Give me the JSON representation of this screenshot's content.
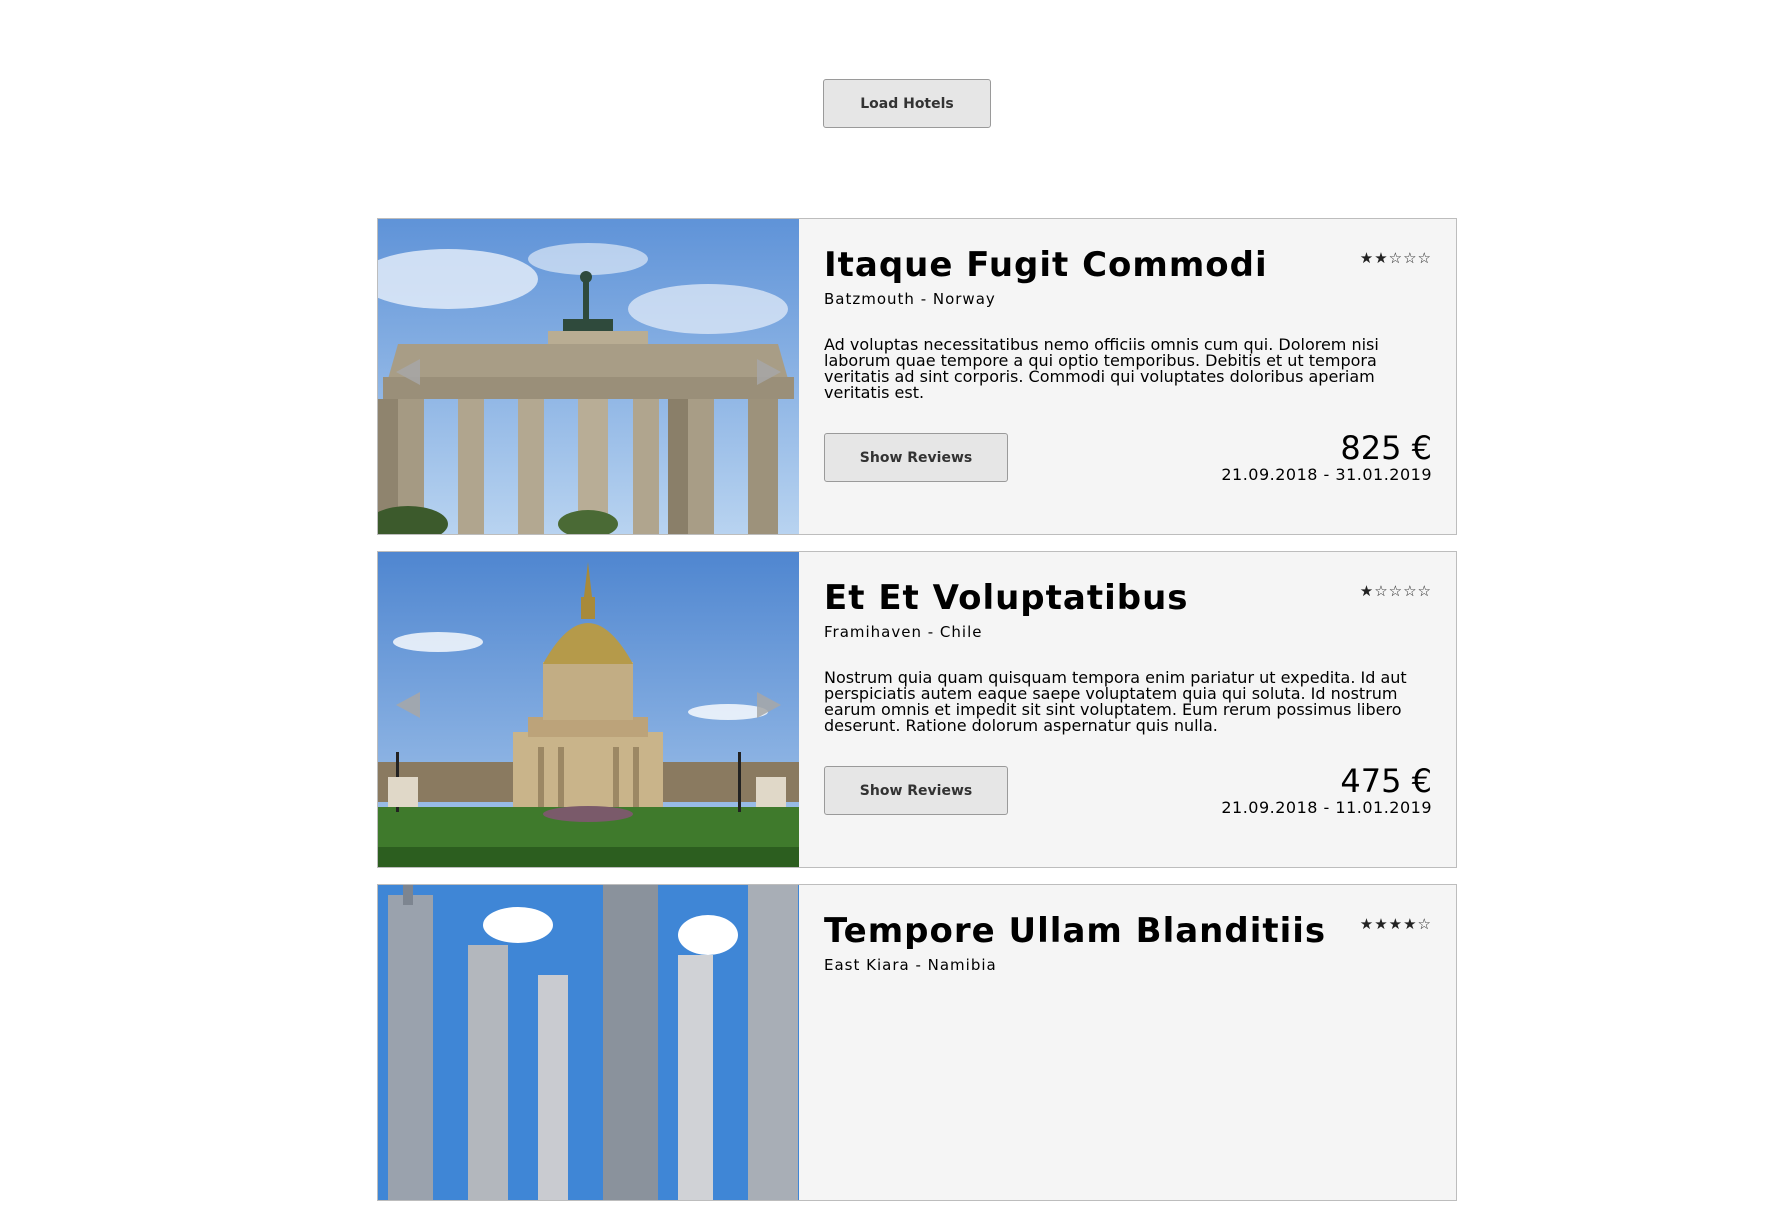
{
  "load_button_label": "Load Hotels",
  "reviews_button_label": "Show Reviews",
  "hotels": [
    {
      "name": "Itaque Fugit Commodi",
      "location": "Batzmouth - Norway",
      "rating": 2,
      "stars_text": "★★☆☆☆",
      "description": "Ad voluptas necessitatibus nemo officiis omnis cum qui. Dolorem nisi laborum quae tempore a qui optio temporibus. Debitis et ut tempora veritatis ad sint corporis. Commodi qui voluptates doloribus aperiam veritatis est.",
      "price": "825 €",
      "dates": "21.09.2018 - 31.01.2019"
    },
    {
      "name": "Et Et Voluptatibus",
      "location": "Framihaven - Chile",
      "rating": 1,
      "stars_text": "★☆☆☆☆",
      "description": "Nostrum quia quam quisquam tempora enim pariatur ut expedita. Id aut perspiciatis autem eaque saepe voluptatem quia qui soluta. Id nostrum earum omnis et impedit sit sint voluptatem. Eum rerum possimus libero deserunt. Ratione dolorum aspernatur quis nulla.",
      "price": "475 €",
      "dates": "21.09.2018 - 11.01.2019"
    },
    {
      "name": "Tempore Ullam Blanditiis",
      "location": "East Kiara - Namibia",
      "rating": 4,
      "stars_text": "★★★★☆"
    }
  ],
  "colors": {
    "card_background": "#f5f5f5",
    "card_border": "#bdbdbd",
    "button_background": "#e6e6e6",
    "arrow": "#a7a7a7"
  },
  "icons": {
    "prev": "arrow-left-icon",
    "next": "arrow-right-icon",
    "star": "star-icon"
  }
}
